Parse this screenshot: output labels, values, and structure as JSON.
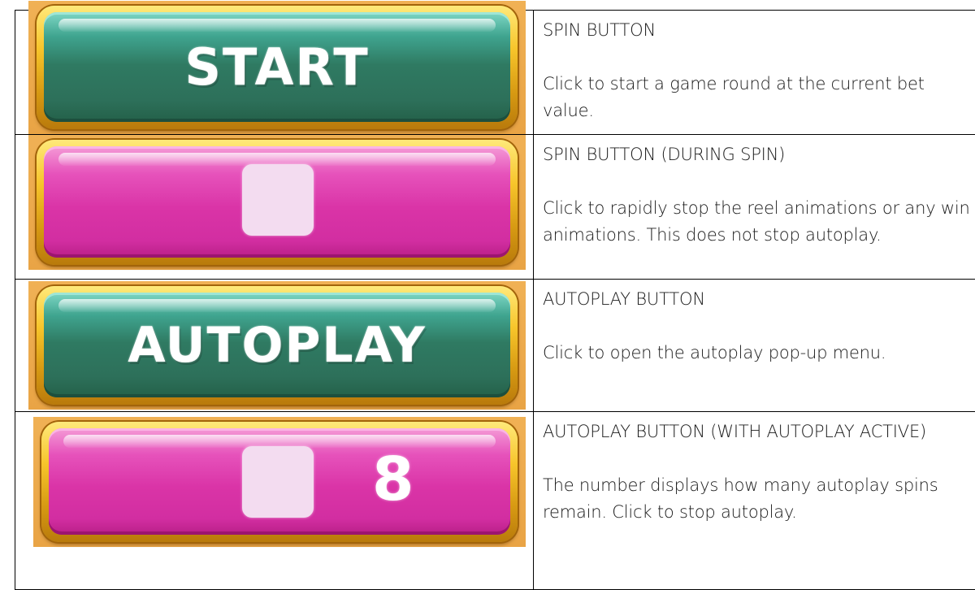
{
  "rows": [
    {
      "button": {
        "label": "START",
        "style": "green"
      },
      "title": "SPIN BUTTON",
      "body": "Click to start a game round at the current bet value."
    },
    {
      "button": {
        "label": "",
        "style": "pink",
        "icon": "stop-square-icon"
      },
      "title": "SPIN BUTTON (DURING SPIN)",
      "body": "Click to rapidly stop the reel animations or any win animations. This does not stop autoplay."
    },
    {
      "button": {
        "label": "AUTOPLAY",
        "style": "green"
      },
      "title": "AUTOPLAY BUTTON",
      "body": "Click to open the autoplay pop-up menu."
    },
    {
      "button": {
        "label": "",
        "style": "pink",
        "icon": "stop-square-icon",
        "counter": "8"
      },
      "title": "AUTOPLAY BUTTON (WITH AUTOPLAY ACTIVE)",
      "body": "The number displays how many autoplay spins remain. Click to stop autoplay."
    }
  ],
  "colors": {
    "green_button": "#2d705a",
    "pink_button": "#d22ea1",
    "gold_frame": "#f7c52b",
    "stop_square": "#f3dcf0"
  }
}
